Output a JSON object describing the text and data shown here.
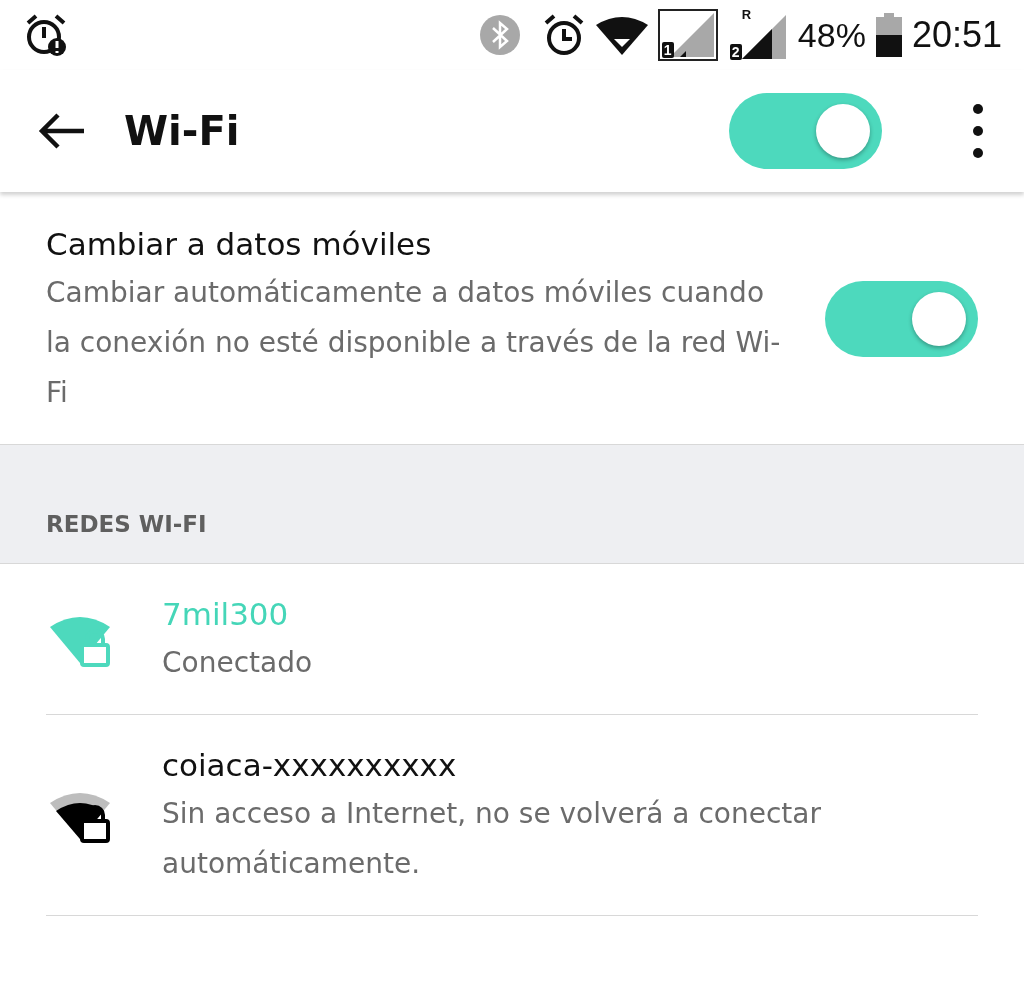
{
  "status_bar": {
    "sim1": "1",
    "roaming": "R",
    "sim2": "2",
    "battery": "48%",
    "time": "20:51"
  },
  "toolbar": {
    "title": "Wi-Fi",
    "wifi_on": true
  },
  "auto_switch": {
    "title": "Cambiar a datos móviles",
    "description": "Cambiar automáticamente a datos móviles cuando la conexión no esté disponible a través de la red Wi-Fi",
    "on": true
  },
  "section_header": "REDES WI-FI",
  "networks": [
    {
      "name": "7mil300",
      "status": "Conectado",
      "connected": true
    },
    {
      "name": "coiaca-xxxxxxxxxx",
      "status": "Sin acceso a Internet, no se volverá a conectar automáticamente.",
      "connected": false
    }
  ]
}
